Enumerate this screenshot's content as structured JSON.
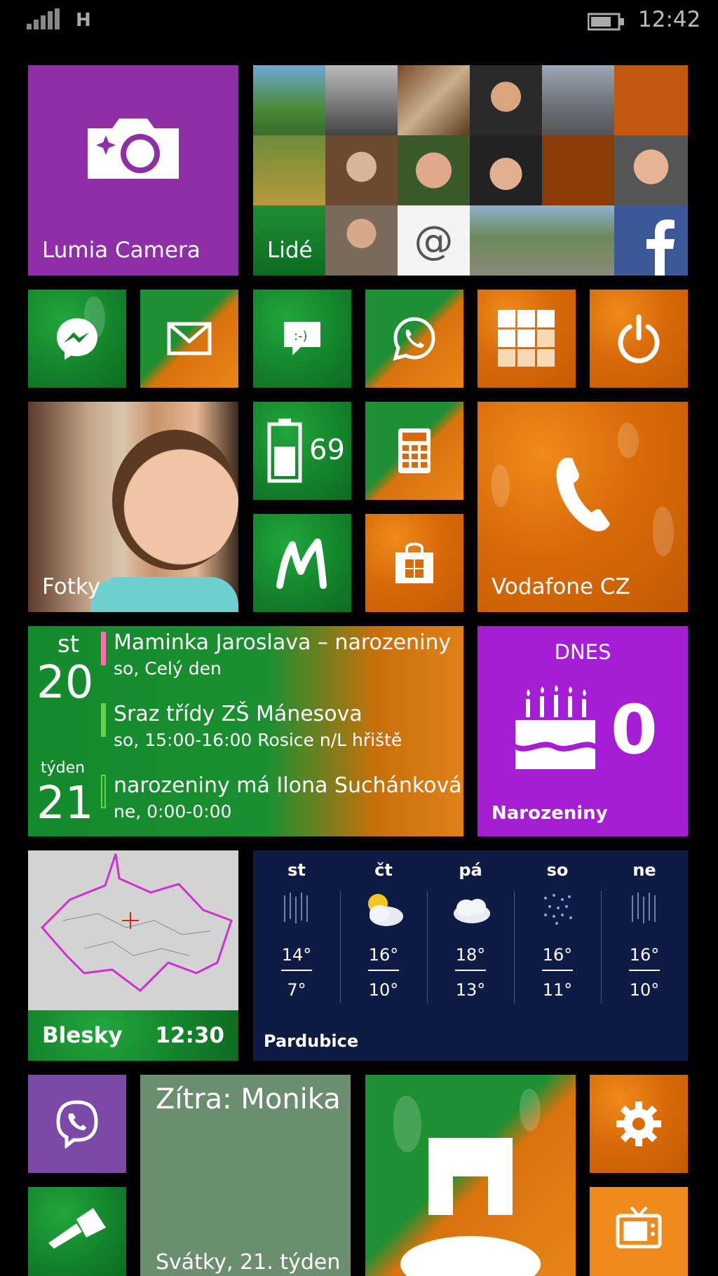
{
  "status_bar": {
    "signal_type": "H",
    "time": "12:42",
    "signal-icon": "signal-bars-icon",
    "battery-icon": "battery-icon"
  },
  "tiles": {
    "lumia_camera": {
      "label": "Lumia Camera",
      "icon": "camera-icon",
      "color": "#8e2fa8"
    },
    "people": {
      "label": "Lidé",
      "icon": "people-collage"
    },
    "messenger": {
      "icon": "messenger-icon"
    },
    "mail": {
      "icon": "mail-icon"
    },
    "messaging": {
      "icon": "chat-icon"
    },
    "whatsapp": {
      "icon": "whatsapp-icon"
    },
    "apps_grid": {
      "icon": "grid-icon"
    },
    "power": {
      "icon": "power-icon"
    },
    "photos": {
      "label": "Fotky"
    },
    "battery": {
      "value": "69",
      "icon": "battery-icon"
    },
    "calculator": {
      "icon": "calculator-icon"
    },
    "mtile": {
      "icon": "m-logo-icon"
    },
    "store": {
      "icon": "store-bag-icon"
    },
    "phone": {
      "label": "Vodafone CZ",
      "icon": "phone-icon"
    },
    "calendar": {
      "weekday": "st",
      "day": "20",
      "week_label": "týden",
      "week": "21",
      "events": [
        {
          "title": "Maminka Jaroslava – narozeniny",
          "detail": "so, Celý den",
          "color": "#ff6fb1"
        },
        {
          "title": "Sraz třídy ZŠ Mánesova",
          "detail": "so, 15:00-16:00  Rosice n/L hřiště",
          "color": "#66d44a"
        },
        {
          "title": "narozeniny má Ilona Suchánková",
          "detail": "ne, 0:00-0:00",
          "color": "#66d44a"
        }
      ]
    },
    "birthdays": {
      "header": "DNES",
      "count": "0",
      "label": "Narozeniny",
      "icon": "cake-icon",
      "color": "#a51ed6"
    },
    "blesky": {
      "label": "Blesky",
      "time": "12:30",
      "icon": "map-czech-icon"
    },
    "weather": {
      "city": "Pardubice",
      "days": [
        {
          "day": "st",
          "hi": "14°",
          "lo": "7°",
          "icon": "rain-icon"
        },
        {
          "day": "čt",
          "hi": "16°",
          "lo": "10°",
          "icon": "sun-cloud-icon"
        },
        {
          "day": "pá",
          "hi": "18°",
          "lo": "13°",
          "icon": "cloud-icon"
        },
        {
          "day": "so",
          "hi": "16°",
          "lo": "11°",
          "icon": "drizzle-icon"
        },
        {
          "day": "ne",
          "hi": "16°",
          "lo": "10°",
          "icon": "rain-icon"
        }
      ]
    },
    "viber": {
      "icon": "viber-icon"
    },
    "holidays": {
      "title": "Zítra: Monika",
      "subtitle": "Svátky, 21. týden"
    },
    "maxthon": {
      "icon": "maxthon-icon"
    },
    "settings": {
      "icon": "gear-icon"
    },
    "flashlight": {
      "icon": "flashlight-icon"
    },
    "tv": {
      "icon": "tv-icon"
    }
  }
}
